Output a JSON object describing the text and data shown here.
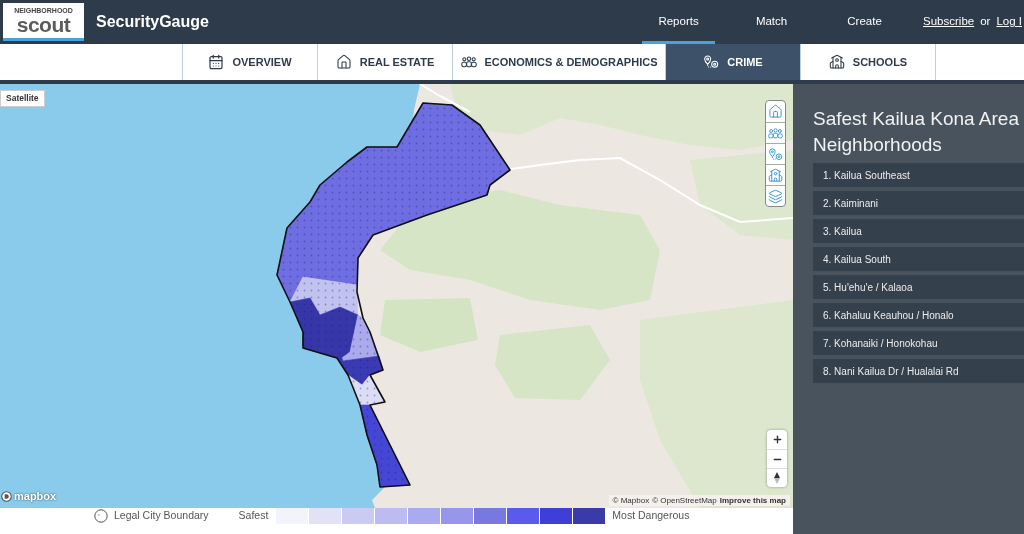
{
  "header": {
    "logo": {
      "tagline": "NEIGHBORHOOD",
      "wordmark": "scout"
    },
    "product": "SecurityGauge",
    "nav": [
      {
        "label": "Reports",
        "selected": true
      },
      {
        "label": "Match",
        "selected": false
      },
      {
        "label": "Create",
        "selected": false
      }
    ],
    "subscribe": "Subscribe",
    "separator": "or",
    "login": "Log I"
  },
  "tabs": [
    {
      "label": "OVERVIEW",
      "selected": false
    },
    {
      "label": "REAL ESTATE",
      "selected": false
    },
    {
      "label": "ECONOMICS & DEMOGRAPHICS",
      "selected": false
    },
    {
      "label": "CRIME",
      "selected": true
    },
    {
      "label": "SCHOOLS",
      "selected": false
    }
  ],
  "map": {
    "satellite_button": "Satellite",
    "logo": "mapbox",
    "attribution": [
      "© Mapbox",
      "© OpenStreetMap"
    ],
    "improve_link": "Improve this map"
  },
  "legend": {
    "boundary_label": "Legal City Boundary",
    "low_label": "Safest",
    "swatches": [
      {
        "color": "#f3f3fb"
      },
      {
        "color": "#e2e2f7"
      },
      {
        "color": "#cacaf3"
      },
      {
        "color": "#bcbcf0"
      },
      {
        "color": "#aaaaee"
      },
      {
        "color": "#9696ea"
      },
      {
        "color": "#7878e0"
      },
      {
        "color": "#5a5aef"
      },
      {
        "color": "#3e3ed8"
      },
      {
        "color": "#3a3aa8"
      }
    ],
    "high_label": "Most Dangerous"
  },
  "sidebar": {
    "title": "Safest Kailua Kona Area Neighborhoods",
    "items": [
      "1. Kailua Southeast",
      "2. Kaiminani",
      "3. Kailua",
      "4. Kailua South",
      "5. Hu'ehu'e / Kalaoa",
      "6. Kahaluu Keauhou / Honalo",
      "7. Kohanaiki / Honokohau",
      "8. Nani Kailua Dr / Hualalai Rd"
    ]
  }
}
